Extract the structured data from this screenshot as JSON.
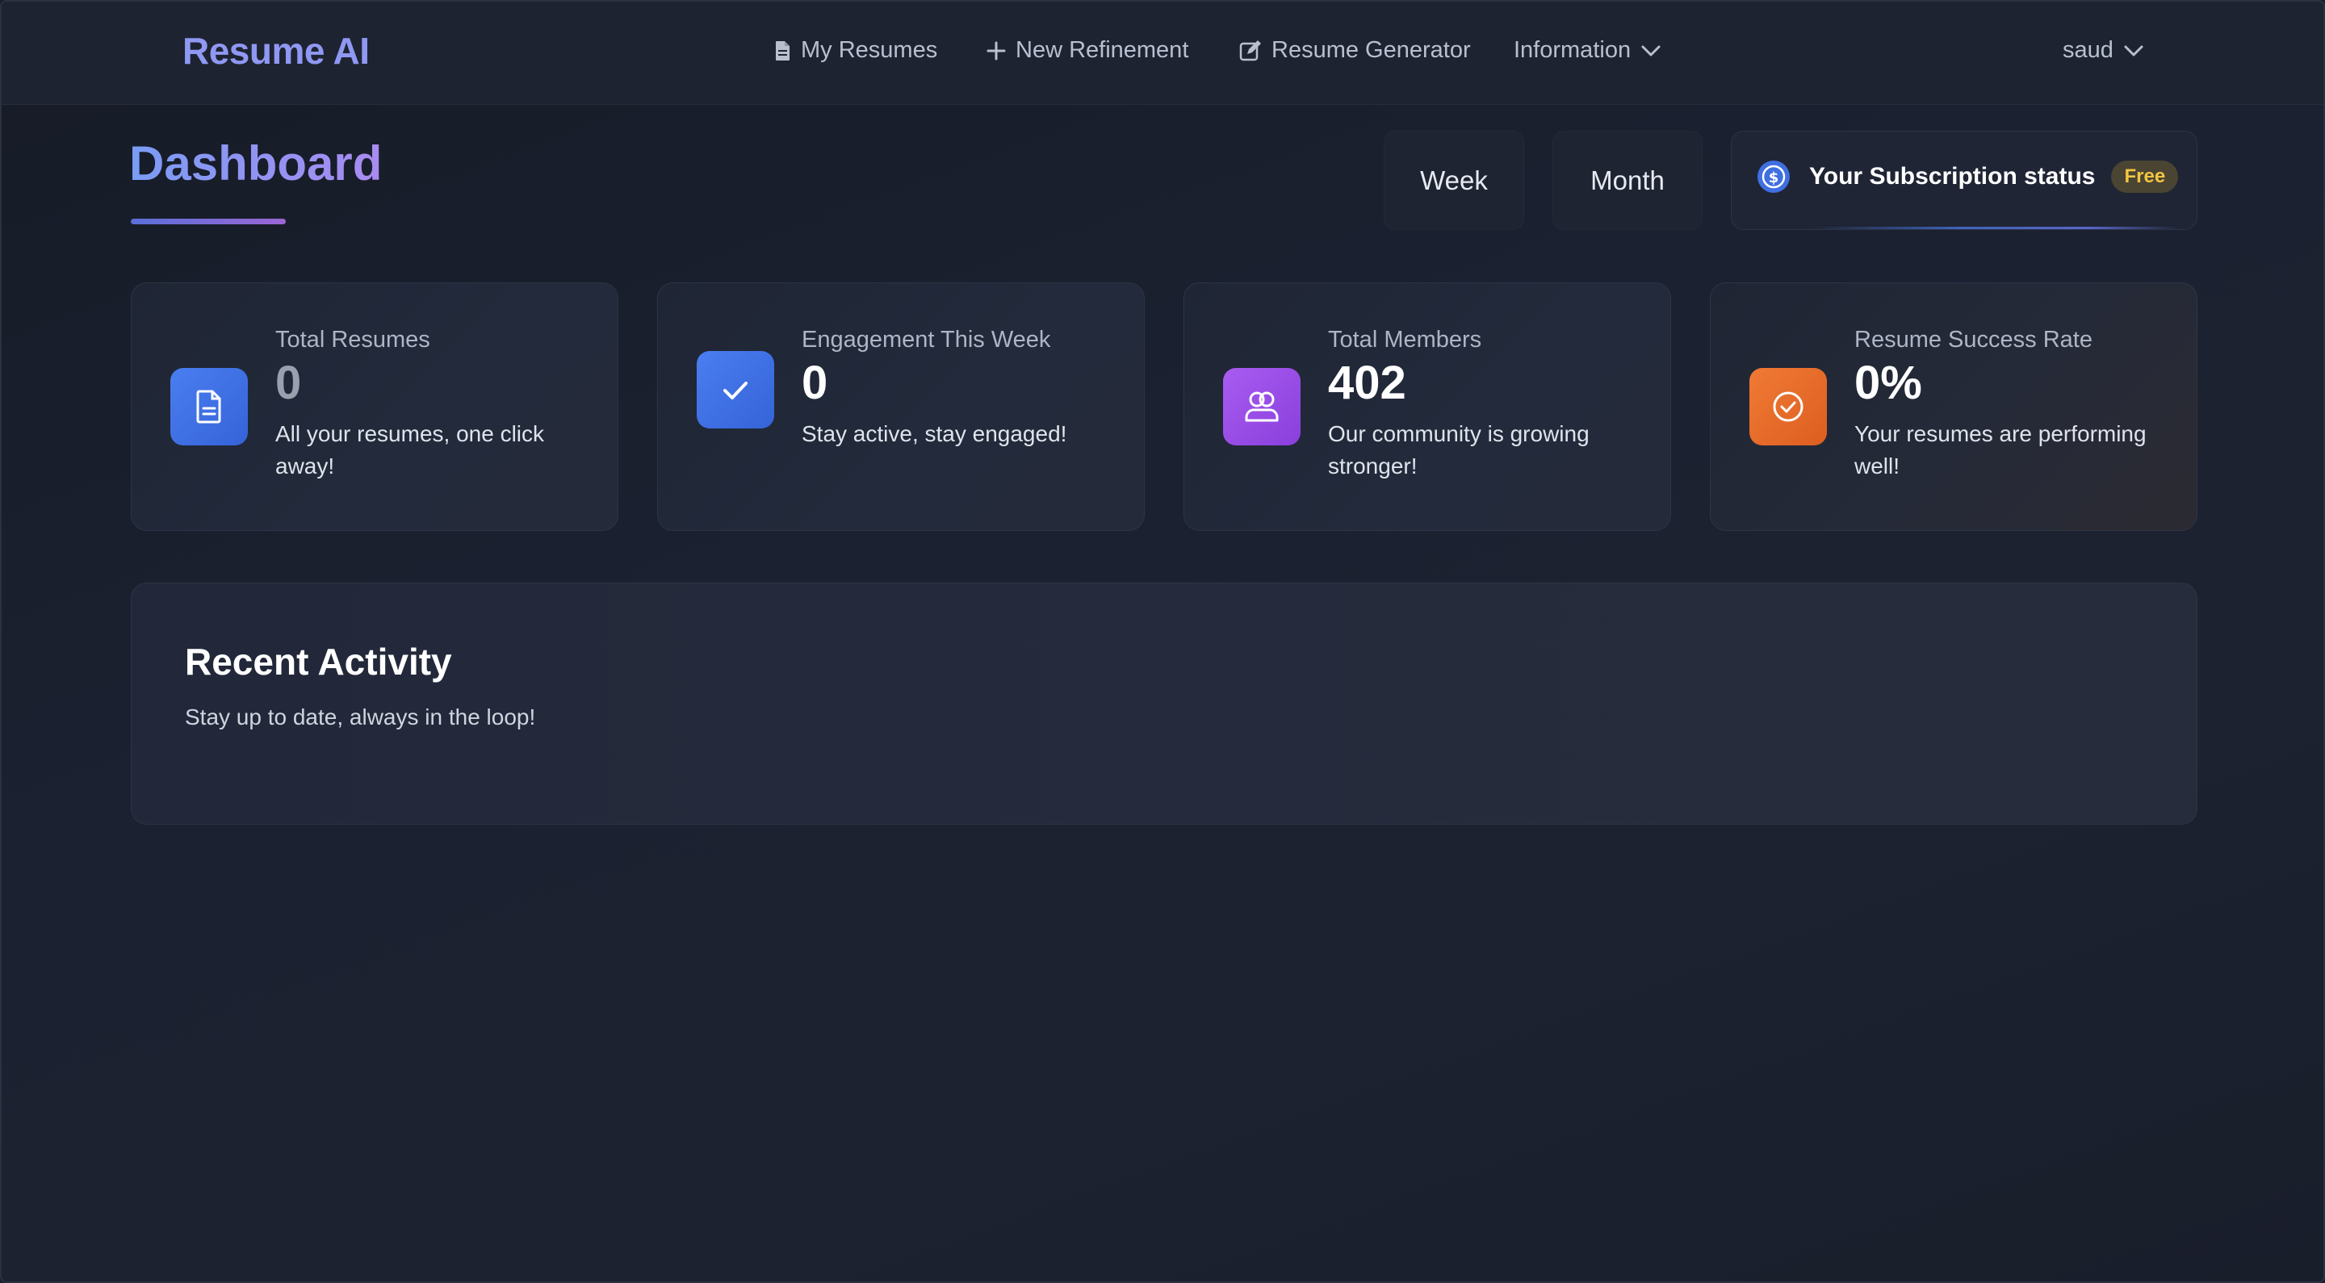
{
  "navbar": {
    "brand": "Resume AI",
    "links": [
      {
        "label": "My Resumes",
        "icon": "file-icon"
      },
      {
        "label": "New Refinement",
        "icon": "plus-icon"
      },
      {
        "label": "Resume Generator",
        "icon": "edit-icon"
      },
      {
        "label": "Information",
        "icon": "chevron-down-icon"
      }
    ],
    "user": "saud"
  },
  "header": {
    "title": "Dashboard",
    "period_buttons": [
      "Week",
      "Month"
    ],
    "subscription": {
      "label": "Your Subscription status",
      "badge": "Free",
      "icon": "dollar-circle-icon"
    }
  },
  "stats": [
    {
      "label": "Total Resumes",
      "value": "0",
      "description": "All your resumes, one click away!",
      "icon": "document-icon",
      "color": "#3f6fe0"
    },
    {
      "label": "Engagement This Week",
      "value": "0",
      "description": "Stay active, stay engaged!",
      "icon": "check-icon",
      "color": "#3f6fe0"
    },
    {
      "label": "Total Members",
      "value": "402",
      "description": "Our community is growing stronger!",
      "icon": "users-icon",
      "color": "#9a4de6"
    },
    {
      "label": "Resume Success Rate",
      "value": "0%",
      "description": "Your resumes are performing well!",
      "icon": "check-circle-icon",
      "color": "#ea6d2a"
    }
  ],
  "recent_activity": {
    "title": "Recent Activity",
    "subtitle": "Stay up to date, always in the loop!"
  },
  "colors": {
    "brand": "#8f98f2",
    "badge_text": "#f2c542",
    "background": "#1b2130"
  }
}
